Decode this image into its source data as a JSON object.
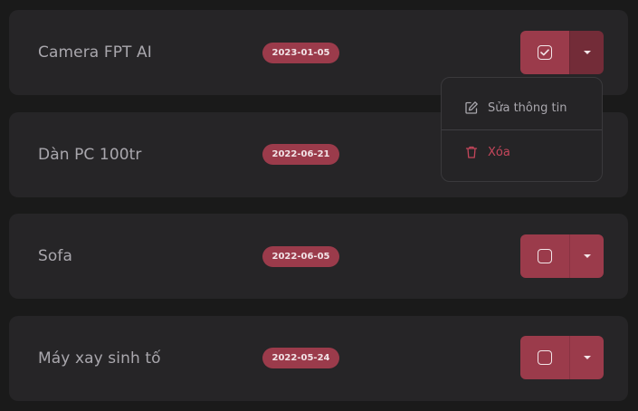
{
  "items": [
    {
      "name": "Camera FPT AI",
      "date": "2023-01-05",
      "checked": true
    },
    {
      "name": "Dàn PC 100tr",
      "date": "2022-06-21",
      "checked": false
    },
    {
      "name": "Sofa",
      "date": "2022-06-05",
      "checked": false
    },
    {
      "name": "Máy xay sinh tố",
      "date": "2022-05-24",
      "checked": false
    }
  ],
  "dropdown": {
    "edit_label": "Sửa thông tin",
    "delete_label": "Xóa"
  },
  "icons": {
    "edit": "pencil-square-icon",
    "delete": "trash-icon",
    "checkbox_checked": "checkbox-checked-icon",
    "checkbox_empty": "checkbox-empty-icon",
    "caret": "caret-down-icon"
  },
  "colors": {
    "background": "#1a1a1a",
    "card": "#262527",
    "accent": "#9b3b4b",
    "accent_active": "#732c38",
    "danger_text": "#c4465b",
    "text": "#a9a7ad"
  }
}
